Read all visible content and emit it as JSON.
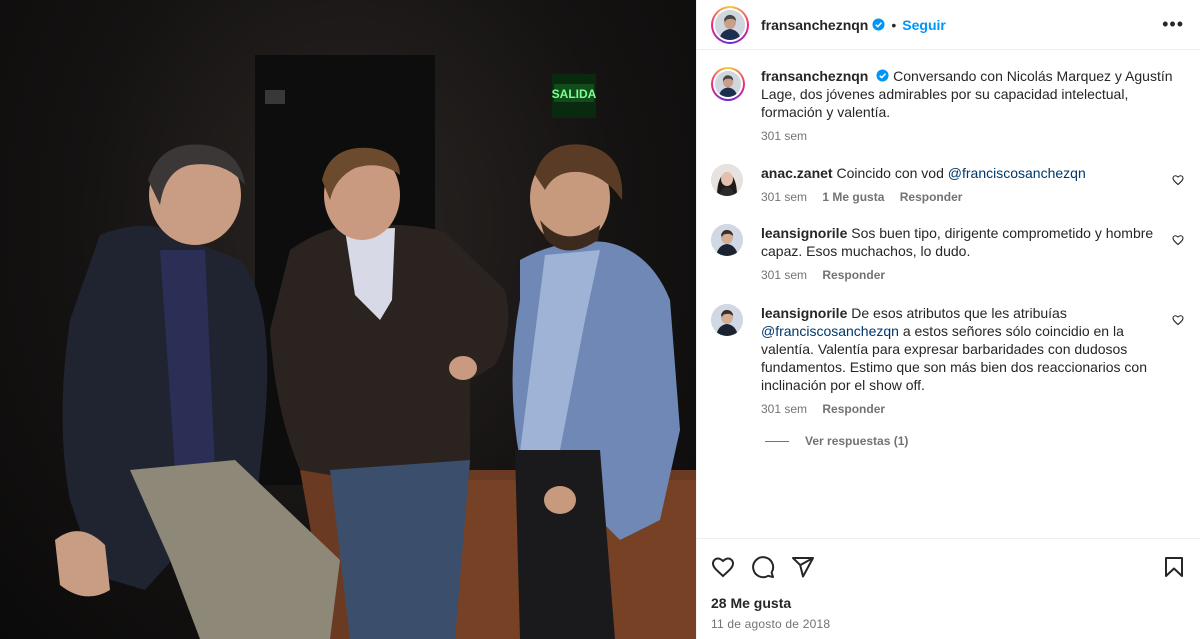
{
  "post": {
    "author": "fransancheznqn",
    "follow_label": "Seguir",
    "dot": "•",
    "more_label": "•••",
    "photo": {
      "exit_sign": "SALIDA"
    }
  },
  "caption": {
    "username": "fransancheznqn",
    "text": "Conversando con Nicolás Marquez y Agustín Lage, dos jóvenes admirables por su capacidad intelectual, formación y valentía.",
    "time": "301 sem"
  },
  "comments": [
    {
      "username": "anac.zanet",
      "text": "Coincido con vod ",
      "mention": "@franciscosanchezqn",
      "time": "301 sem",
      "likes": "1 Me gusta",
      "reply": "Responder"
    },
    {
      "username": "leansignorile",
      "text": "Sos buen tipo, dirigente comprometido y hombre capaz. Esos muchachos, lo dudo.",
      "time": "301 sem",
      "reply": "Responder"
    },
    {
      "username": "leansignorile",
      "mention": "@franciscosanchezqn",
      "text_before": "De esos atributos que les atribuías ",
      "text_after": " a estos señores sólo coincidio en la valentía. Valentía para expresar barbaridades con dudosos fundamentos. Estimo que son más bien dos reaccionarios con inclinación por el show off.",
      "time": "301 sem",
      "reply": "Responder",
      "view_replies": "Ver respuestas (1)"
    }
  ],
  "footer": {
    "likes": "28 Me gusta",
    "date": "11 de agosto de 2018"
  },
  "icons": {
    "like": "heart-icon",
    "comment": "comment-icon",
    "share": "share-icon",
    "save": "bookmark-icon"
  },
  "colors": {
    "link": "#0095f6",
    "mention": "#00376b",
    "muted": "#737373"
  }
}
